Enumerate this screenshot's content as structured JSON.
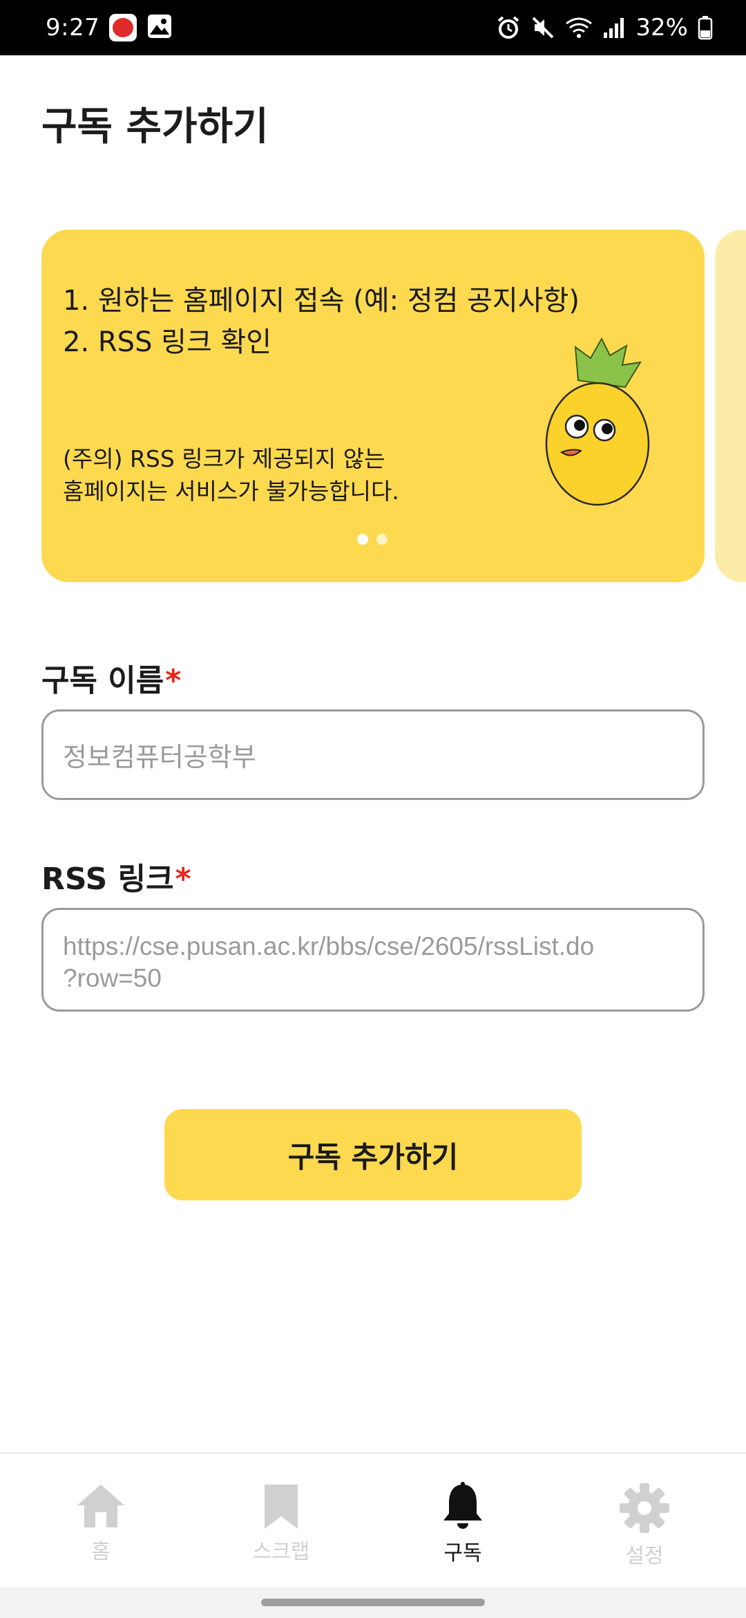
{
  "status_bar": {
    "time": "9:27",
    "battery": "32%",
    "icons": [
      "app-notification-icon",
      "gallery-icon",
      "alarm-icon",
      "mute-icon",
      "wifi-icon",
      "signal-icon",
      "battery-icon"
    ]
  },
  "header": {
    "title": "구독 추가하기"
  },
  "carousel": {
    "step1": "1. 원하는 홈페이지 접속 (예: 정컴 공지사항)",
    "step2": "2. RSS 링크 확인",
    "warning_line1": "(주의) RSS 링크가 제공되지 않는",
    "warning_line2": "홈페이지는 서비스가 불가능합니다.",
    "page_count": 2,
    "active_page": 1,
    "card_color": "#fdd94f"
  },
  "form": {
    "name_label": "구독 이름",
    "name_required": "*",
    "name_placeholder": "정보컴퓨터공학부",
    "rss_label": "RSS 링크",
    "rss_required": "*",
    "rss_placeholder_line1": "https://cse.pusan.ac.kr/bbs/cse/2605/rssList.do",
    "rss_placeholder_line2": "?row=50",
    "submit_label": "구독 추가하기"
  },
  "bottom_nav": {
    "items": [
      {
        "label": "홈",
        "icon": "home-icon",
        "active": false
      },
      {
        "label": "스크랩",
        "icon": "bookmark-icon",
        "active": false
      },
      {
        "label": "구독",
        "icon": "bell-icon",
        "active": true
      },
      {
        "label": "설정",
        "icon": "gear-icon",
        "active": false
      }
    ]
  },
  "colors": {
    "accent": "#fdd94f",
    "required": "#e8241c",
    "inactive_nav": "#d0d0d0"
  }
}
